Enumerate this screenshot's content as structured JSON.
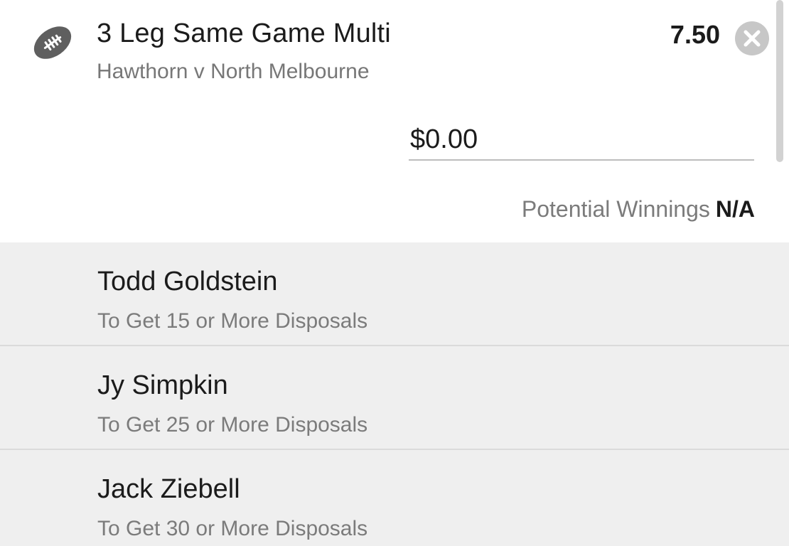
{
  "bet": {
    "title": "3 Leg Same Game Multi",
    "subtitle": "Hawthorn v North Melbourne",
    "odds": "7.50",
    "sport_icon": "football-icon",
    "close_icon": "close-icon"
  },
  "stake": {
    "value": "$0.00"
  },
  "winnings": {
    "label": "Potential Winnings",
    "value": "N/A"
  },
  "legs": [
    {
      "name": "Todd Goldstein",
      "market": "To Get 15 or More Disposals"
    },
    {
      "name": "Jy Simpkin",
      "market": "To Get 25 or More Disposals"
    },
    {
      "name": "Jack Ziebell",
      "market": "To Get 30 or More Disposals"
    }
  ]
}
